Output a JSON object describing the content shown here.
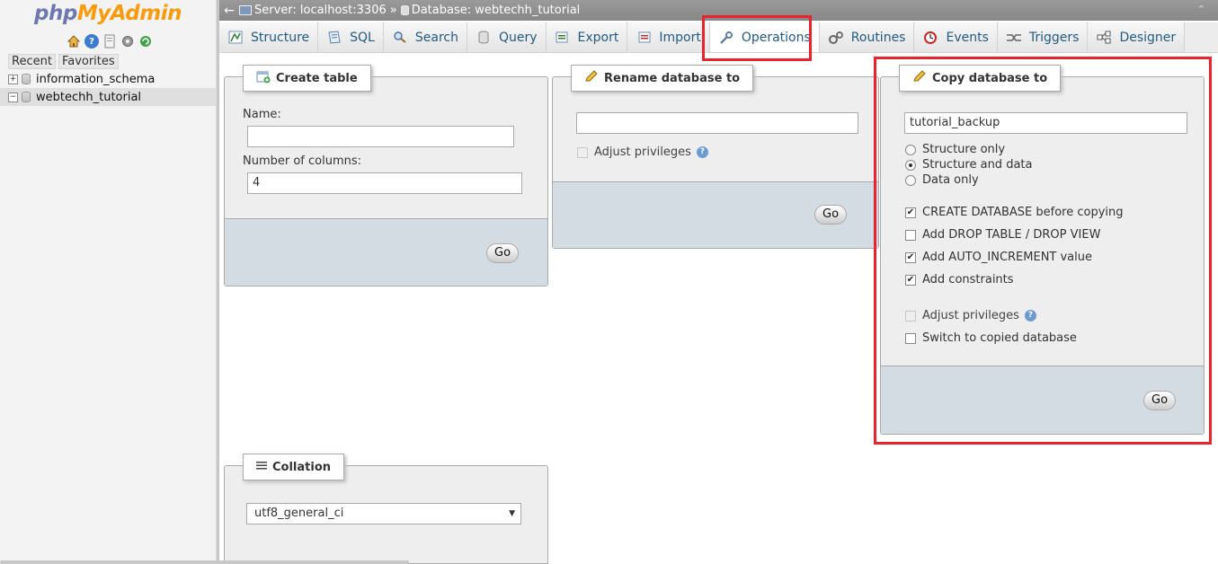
{
  "nav": {
    "logo_part1": "php",
    "logo_part2": "MyAdmin",
    "tabs": {
      "recent": "Recent",
      "favorites": "Favorites"
    },
    "tree": [
      {
        "label": "information_schema",
        "expander": "+"
      },
      {
        "label": "webtechh_tutorial",
        "expander": "−"
      }
    ]
  },
  "serverbar": {
    "back": "←",
    "server": "Server: localhost:3306",
    "separator": "»",
    "database": "Database: webtechh_tutorial",
    "collapse": "⌃"
  },
  "tabs": [
    {
      "label": "Structure"
    },
    {
      "label": "SQL"
    },
    {
      "label": "Search"
    },
    {
      "label": "Query"
    },
    {
      "label": "Export"
    },
    {
      "label": "Import"
    },
    {
      "label": "Operations"
    },
    {
      "label": "Routines"
    },
    {
      "label": "Events"
    },
    {
      "label": "Triggers"
    },
    {
      "label": "Designer"
    }
  ],
  "create_table": {
    "legend": "Create table",
    "name_label": "Name:",
    "name_value": "",
    "columns_label": "Number of columns:",
    "columns_value": "4",
    "go": "Go"
  },
  "rename_db": {
    "legend": "Rename database to",
    "value": "",
    "adjust_privileges": "Adjust privileges",
    "go": "Go"
  },
  "copy_db": {
    "legend": "Copy database to",
    "value": "tutorial_backup",
    "options": [
      {
        "label": "Structure only",
        "selected": false
      },
      {
        "label": "Structure and data",
        "selected": true
      },
      {
        "label": "Data only",
        "selected": false
      }
    ],
    "create_database": "CREATE DATABASE before copying",
    "drop_table": "Add DROP TABLE / DROP VIEW",
    "auto_increment": "Add AUTO_INCREMENT value",
    "constraints": "Add constraints",
    "adjust_privileges": "Adjust privileges",
    "switch_db": "Switch to copied database",
    "go": "Go"
  },
  "collation": {
    "legend": "Collation",
    "selected": "utf8_general_ci"
  },
  "colors": {
    "highlight": "#e8232e",
    "link": "#235a81",
    "footer": "#d3dce3"
  }
}
